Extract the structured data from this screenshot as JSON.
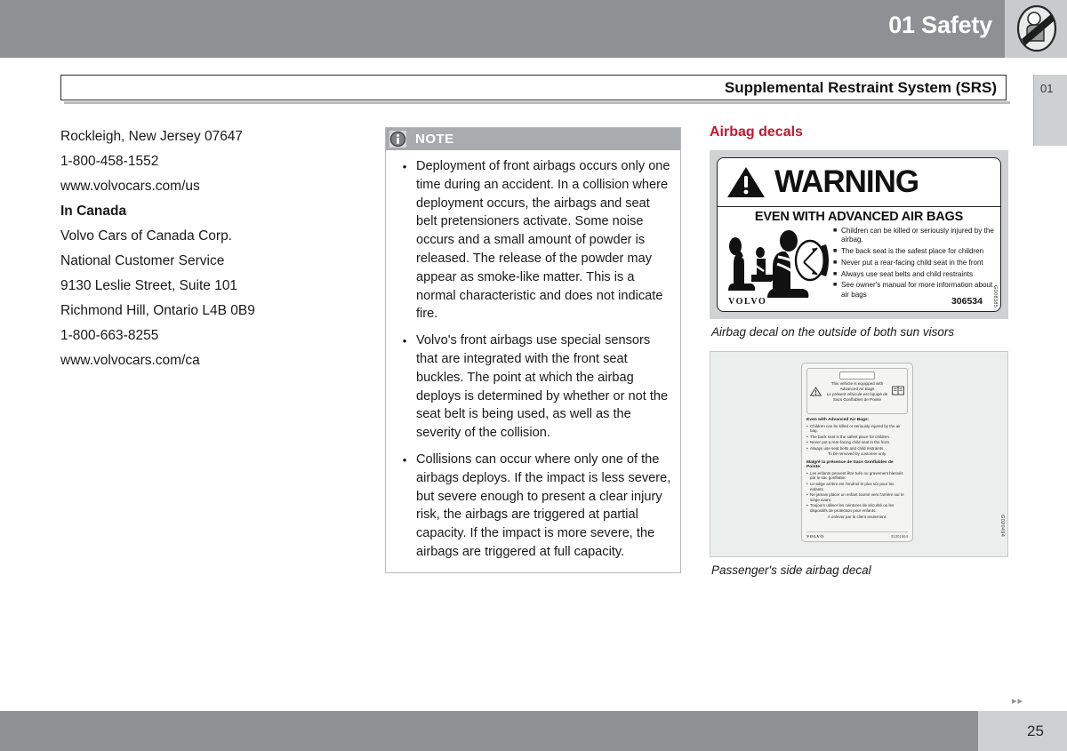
{
  "header": {
    "chapter_title": "01 Safety",
    "icon": "occupant-seatbelt-icon",
    "band_color": "#8e9094"
  },
  "title_bar": {
    "section_title": "Supplemental Restraint System (SRS)"
  },
  "chapter_tab": {
    "label": "01"
  },
  "address": {
    "lines": [
      {
        "text": "Rockleigh, New Jersey 07647",
        "bold": false
      },
      {
        "text": "1-800-458-1552",
        "bold": false
      },
      {
        "text": "www.volvocars.com/us",
        "bold": false
      },
      {
        "text": "In Canada",
        "bold": true
      },
      {
        "text": "Volvo Cars of Canada Corp.",
        "bold": false
      },
      {
        "text": "National Customer Service",
        "bold": false
      },
      {
        "text": "9130 Leslie Street, Suite 101",
        "bold": false
      },
      {
        "text": "Richmond Hill, Ontario L4B 0B9",
        "bold": false
      },
      {
        "text": "1-800-663-8255",
        "bold": false
      },
      {
        "text": "www.volvocars.com/ca",
        "bold": false
      }
    ]
  },
  "note": {
    "label": "NOTE",
    "icon": "info-circle-icon",
    "bullet_glyph": "•",
    "bullets": [
      "Deployment of front airbags occurs only one time during an accident. In a collision where deployment occurs, the airbags and seat belt pretensioners activate. Some noise occurs and a small amount of powder is released. The release of the powder may appear as smoke-like matter. This is a normal characteristic and does not indicate fire.",
      "Volvo's front airbags use special sensors that are integrated with the front seat buckles. The point at which the airbag deploys is determined by whether or not the seat belt is being used, as well as the severity of the collision.",
      "Collisions can occur where only one of the airbags deploys. If the impact is less severe, but severe enough to present a clear injury risk, the airbags are triggered at partial capacity. If the impact is more severe, the airbags are triggered at full capacity."
    ]
  },
  "decals": {
    "heading": "Airbag decals",
    "heading_color": "#c0182f",
    "warning_decal": {
      "word": "WARNING",
      "triangle_icon": "warning-triangle-icon",
      "subtitle": "EVEN WITH ADVANCED AIR BAGS",
      "square_glyph": "■",
      "bullets": [
        "Children can be killed or seriously injured by the airbag.",
        "The back seat is the safest place for children",
        "Never put a rear-facing child seat in the front",
        "Always use seat belts and child restraints",
        "See owner's manual for more information about air bags"
      ],
      "brand": "VOLVO",
      "part_number": "306534",
      "side_code": "G008385",
      "caption": "Airbag decal on the outside of both sun visors"
    },
    "passenger_decal": {
      "header_en": "This vehicle is equipped with Advanced Air Bags",
      "header_fr": "Le présent véhicule est équipé de Sacs Gonflables de Pointe",
      "triangle_icon": "warning-triangle-icon",
      "book_icon": "manual-book-icon",
      "section_title_en": "Even with Advanced Air Bags:",
      "bullets_en": [
        "Children can be killed or seriously injured by the air bag.",
        "The back seat is the safest place for children.",
        "Never put a rear-facing child seat in the front.",
        "Always use seat belts and child restraints."
      ],
      "note_en": "To be removed by customer only.",
      "section_title_fr": "Malgré la présence de Sacs Gonflables de Pointe:",
      "bullets_fr": [
        "Les enfants peuvent être tués ou gravement blessés par le sac gonflable.",
        "Le siège arrière est l'endroit le plus sûr pour les enfants.",
        "Ne jamais placer un enfant tourné vers l'arrière sur le siège avant.",
        "Toujours utiliser les ceintures de sécurité ou les dispositifs de protection pour enfants."
      ],
      "note_fr": "À enlever par le client seulement.",
      "brand": "VOLVO",
      "part_number": "31301564",
      "side_code": "G020494",
      "caption": "Passenger's side airbag decal"
    }
  },
  "footer": {
    "page_number": "25",
    "arrows": "▸▸"
  }
}
